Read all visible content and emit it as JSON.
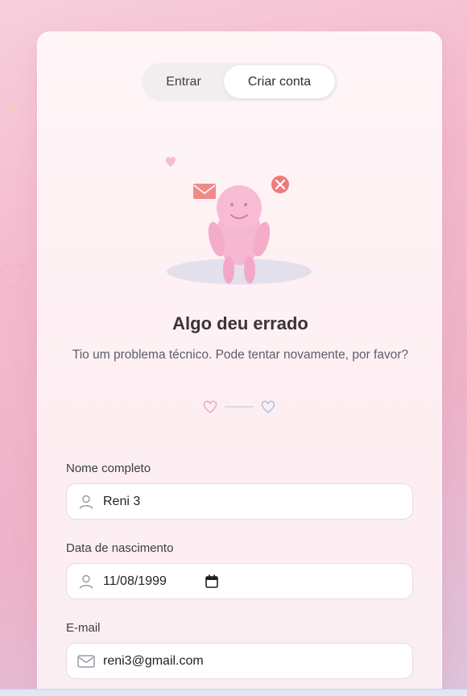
{
  "tabs": [
    {
      "label": "Entrar",
      "active": false
    },
    {
      "label": "Criar conta",
      "active": true
    }
  ],
  "error": {
    "title": "Algo deu errado",
    "message": "Tio um problema técnico. Pode tentar novamente, por favor?"
  },
  "form": {
    "name": {
      "label": "Nome completo",
      "value": "Reni 3",
      "icon": "user-icon"
    },
    "birthdate": {
      "label": "Data de nascimento",
      "value": "11/08/1999",
      "icon": "user-icon"
    },
    "email": {
      "label": "E-mail",
      "value": "reni3@gmail.com",
      "icon": "mail-icon"
    }
  },
  "colors": {
    "accent_pink": "#f4a3c4",
    "error_red": "#ee6f6f",
    "heart_blue": "#9fc4ef"
  }
}
